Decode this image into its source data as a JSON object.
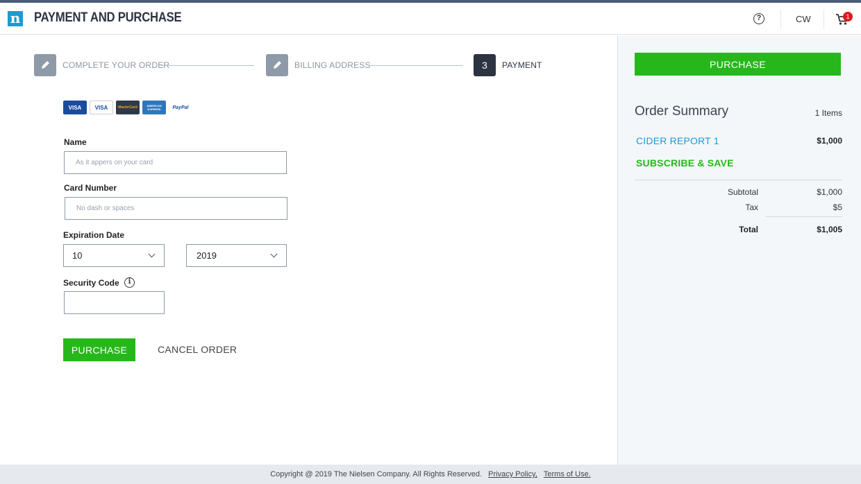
{
  "header": {
    "logo_letter": "n",
    "title": "PAYMENT AND PURCHASE",
    "help_symbol": "?",
    "user_initials": "CW",
    "cart_count": "1"
  },
  "steps": [
    {
      "label": "COMPLETE YOUR ORDER",
      "state": "done",
      "icon": "pencil-icon"
    },
    {
      "label": "BILLING ADDRESS",
      "state": "done",
      "icon": "pencil-icon"
    },
    {
      "label": "PAYMENT",
      "state": "active",
      "number": "3"
    }
  ],
  "cards": [
    {
      "name": "VISA",
      "bg": "#1a4c9c",
      "fg": "#ffffff"
    },
    {
      "name": "VISA",
      "bg": "#ffffff",
      "fg": "#1a4c9c"
    },
    {
      "name": "MasterCard",
      "bg": "#2d3a4a",
      "fg": "#f7a21b"
    },
    {
      "name": "AMERICAN EXPRESS",
      "bg": "#2e77bb",
      "fg": "#ffffff"
    },
    {
      "name": "PayPal",
      "bg": "#ffffff",
      "fg": "#1a4c9c"
    }
  ],
  "form": {
    "name_label": "Name",
    "name_placeholder": "As it appers on your card",
    "card_label": "Card Number",
    "card_placeholder": "No dash or spaces",
    "exp_label": "Expiration Date",
    "exp_month": "10",
    "exp_year": "2019",
    "security_label": "Security Code",
    "info_symbol": "i",
    "purchase_label": "PURCHASE",
    "cancel_label": "CANCEL ORDER"
  },
  "summary": {
    "purchase_label": "PURCHASE",
    "title": "Order Summary",
    "item_count": "1 Items",
    "item_name": "CIDER REPORT 1",
    "item_price": "$1,000",
    "subscribe_label": "SUBSCRIBE & SAVE",
    "subtotal_label": "Subtotal",
    "subtotal_value": "$1,000",
    "tax_label": "Tax",
    "tax_value": "$5",
    "total_label": "Total",
    "total_value": "$1,005"
  },
  "footer": {
    "copyright": "Copyright @ 2019 The Nielsen Company. All Rights Reserved.",
    "privacy": "Privacy Policy,",
    "terms": "Terms of Use."
  },
  "colors": {
    "accent_green": "#26b81a",
    "accent_blue": "#1c9ad6",
    "dark_navy": "#2c3442",
    "top_strip": "#4a5e78"
  }
}
